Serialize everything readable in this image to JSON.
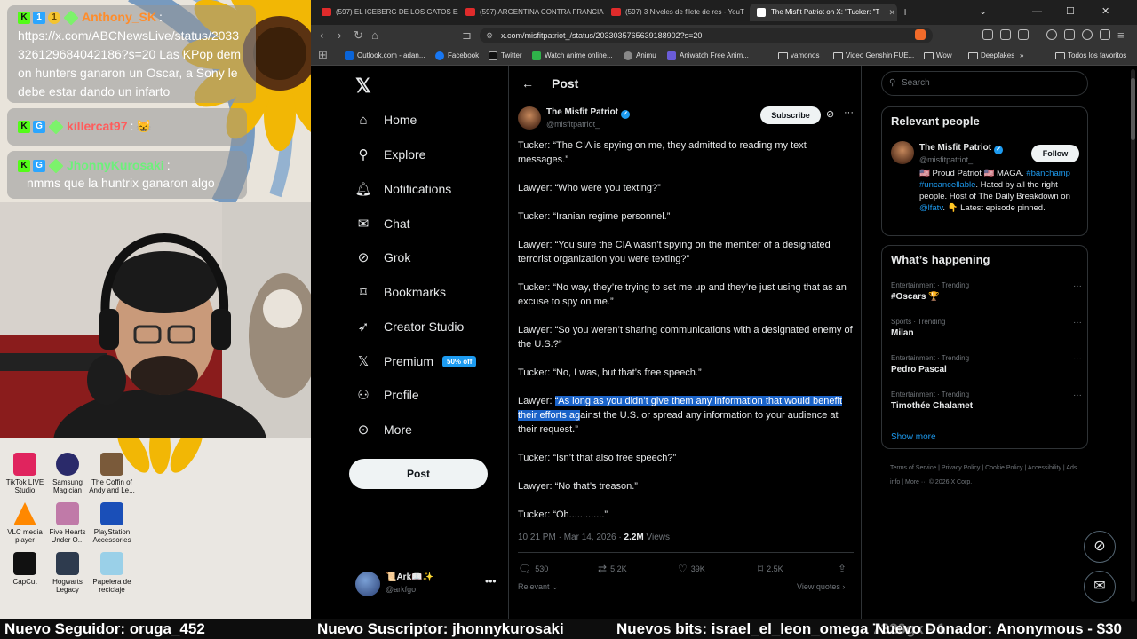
{
  "stream": {
    "chat": [
      {
        "user": "Anthony_SK",
        "user_color": "#ff8c2a",
        "message": "https://x.com/ABCNewsLive/status/2033326129684042186?s=20 Las KPop demon hunters ganaron un Oscar, a Sony le debe estar dando un infarto"
      },
      {
        "user": "killercat97",
        "user_color": "#ff5c5c",
        "message": "😸"
      },
      {
        "user": "JhonnyKurosaki",
        "user_color": "#6cf07a",
        "message": "nmms que la huntrix ganaron algo"
      }
    ],
    "desktop_icons": [
      {
        "label": "TikTok LIVE Studio",
        "color": "#e0245e"
      },
      {
        "label": "Samsung Magician",
        "color": "#2a2a6a"
      },
      {
        "label": "The Coffin of Andy and Le...",
        "color": "#7a5a3a"
      },
      {
        "label": "VLC media player",
        "color": "#ff8800"
      },
      {
        "label": "Five Hearts Under O...",
        "color": "#c07aa8"
      },
      {
        "label": "PlayStation Accessories",
        "color": "#1a4fb8"
      },
      {
        "label": "CapCut",
        "color": "#111111"
      },
      {
        "label": "Hogwarts Legacy",
        "color": "#2e3b4e"
      },
      {
        "label": "Papelera de reciclaje",
        "color": "#9ad0e8"
      }
    ],
    "ticker": [
      "Nuevo Seguidor: oruga_452",
      "Nuevo Suscriptor: jhonnykurosaki",
      "Nuevos bits: israel_el_leon_omega 7320gx - 1",
      "Nuevo Donador: Anonymous - $30"
    ]
  },
  "browser": {
    "tabs": [
      {
        "label": "(597) EL ICEBERG DE LOS GATOS EXP",
        "active": false
      },
      {
        "label": "(597) ARGENTINA CONTRA FRANCIA",
        "active": false
      },
      {
        "label": "(597) 3 Niveles de filete de res - YouT",
        "active": false
      },
      {
        "label": "The Misfit Patriot on X: \"Tucker: \"T",
        "active": true
      }
    ],
    "url": "x.com/misfitpatriot_/status/2033035765639188902?s=20",
    "bookmarks": [
      {
        "label": "Outlook.com - adan...",
        "color": "#0a64d8"
      },
      {
        "label": "Facebook",
        "color": "#1877f2"
      },
      {
        "label": "Twitter",
        "color": "#111111"
      },
      {
        "label": "Watch anime online...",
        "color": "#2fb34a"
      },
      {
        "label": "Animu",
        "color": "#888888"
      },
      {
        "label": "Aniwatch Free Anim...",
        "color": "#6a5cd8"
      },
      {
        "label": "vamonos",
        "folder": true
      },
      {
        "label": "Video Genshin FUE...",
        "folder": true
      },
      {
        "label": "Wow",
        "folder": true
      },
      {
        "label": "Deepfakes",
        "folder": true
      },
      {
        "label": "Todos los favoritos",
        "folder": true
      }
    ]
  },
  "x": {
    "nav": [
      {
        "label": "Home",
        "icon": "home-icon"
      },
      {
        "label": "Explore",
        "icon": "search-icon"
      },
      {
        "label": "Notifications",
        "icon": "bell-icon"
      },
      {
        "label": "Chat",
        "icon": "mail-icon"
      },
      {
        "label": "Grok",
        "icon": "grok-icon"
      },
      {
        "label": "Bookmarks",
        "icon": "bookmark-icon"
      },
      {
        "label": "Creator Studio",
        "icon": "rocket-icon"
      },
      {
        "label": "Premium",
        "icon": "x-icon"
      },
      {
        "label": "Profile",
        "icon": "person-icon"
      },
      {
        "label": "More",
        "icon": "more-circle-icon"
      }
    ],
    "premium_badge": "50% off",
    "post_button": "Post",
    "account": {
      "name": "📜Ark📖✨",
      "handle": "@arkfgo"
    },
    "header_title": "Post",
    "author": {
      "name": "The Misfit Patriot",
      "handle": "@misfitpatriot_"
    },
    "subscribe": "Subscribe",
    "lines": [
      "Tucker: “The CIA is spying on me, they admitted to reading my text messages.”",
      "Lawyer: “Who were you texting?”",
      "Tucker: “Iranian regime personnel.”",
      "Lawyer: “You sure the CIA wasn’t spying on the member of a designated terrorist organization you were texting?”",
      "Tucker: “No way, they’re trying to set me up and they’re just using that as an excuse to spy on me.”",
      "Lawyer: “So you weren’t sharing communications with a designated enemy of the U.S.?”",
      "Tucker: “No, I was, but that’s free speech.”"
    ],
    "line8_prefix": "Lawyer: ",
    "line8_highlight": "“As long as you didn’t give them any information that would benefit their efforts ag",
    "line8_rest": "ainst the U.S. or spread any information to your audience at their request.”",
    "lines_end": [
      "Tucker: “Isn’t that also free speech?”",
      "Lawyer: “No that’s treason.”",
      "Tucker: “Oh.............”"
    ],
    "meta": {
      "time": "10:21 PM · Mar 14, 2026 · ",
      "views": "2.2M",
      "views_label": " Views"
    },
    "actions": {
      "replies": "530",
      "reposts": "5.2K",
      "likes": "39K",
      "bookmarks": "2.5K"
    },
    "relevant": "Relevant",
    "view_quotes": "View quotes",
    "search_placeholder": "Search",
    "relevant_people": {
      "title": "Relevant people",
      "name": "The Misfit Patriot",
      "handle": "@misfitpatriot_",
      "follow": "Follow",
      "bio_1": "🇺🇸 Proud Patriot 🇺🇸 MAGA. ",
      "bio_tags": "#banchamp #uncancellable",
      "bio_2": ". Hated by all the right people. Host of The Daily Breakdown on ",
      "bio_link": "@lfatv",
      "bio_3": ". 👇 Latest episode pinned."
    },
    "happening": {
      "title": "What’s happening",
      "trends": [
        {
          "category": "Entertainment · Trending",
          "title": "#Oscars 🏆"
        },
        {
          "category": "Sports · Trending",
          "title": "Milan"
        },
        {
          "category": "Entertainment · Trending",
          "title": "Pedro Pascal"
        },
        {
          "category": "Entertainment · Trending",
          "title": "Timothée Chalamet"
        }
      ],
      "show_more": "Show more"
    },
    "footer": "Terms of Service   |   Privacy Policy   |   Cookie Policy   |   Accessibility   |   Ads info   |   More ···   © 2026 X Corp."
  }
}
